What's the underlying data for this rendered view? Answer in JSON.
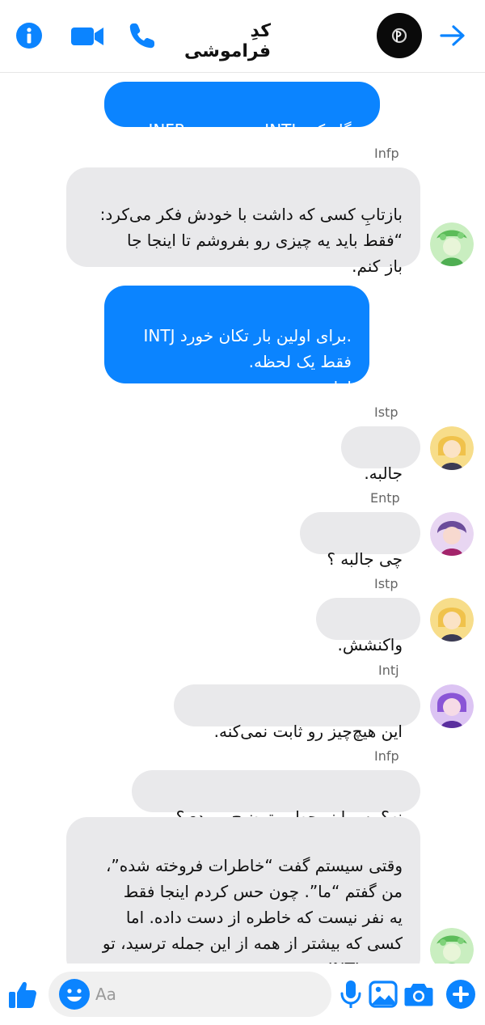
{
  "header": {
    "title": "کدِ فراموشی",
    "icons": {
      "info": "info-icon",
      "video": "video-camera-icon",
      "call": "phone-icon",
      "forward": "arrow-right-icon"
    },
    "accent": "#0b84ff"
  },
  "messages": [
    {
      "text": ".نگاه کرد INTJ مستقیم به INFP"
    },
    {
      "sender": "Infp",
      "text": "بازتابِ کسی که داشت با خودش فکر می‌کرد:\n“فقط باید یه چیزی رو بفروشم تا اینجا جا\nباز کنم."
    },
    {
      "text": ".برای اولین بار تکان خورد INTJ\nفقط یک لحظه.\nاما همه دیدند."
    },
    {
      "sender": "Istp",
      "text": "جالبه."
    },
    {
      "sender": "Entp",
      "text": "چی جالبه ؟"
    },
    {
      "sender": "Istp",
      "text": "واکنشش."
    },
    {
      "sender": "Intj",
      "text": "این هیچ‌چیز رو ثابت نمی‌کنه."
    },
    {
      "sender": "Infp",
      "text": "نه؟ پس اینو چطور توضیح می‌دی؟"
    },
    {
      "text": "وقتی سیستم گفت “خاطرات فروخته شده”،\nمن گفتم “ما”. چون حس کردم اینجا فقط\nیه نفر نیست که خاطره از دست داده. اما\nکسی که بیشتر از همه از این جمله ترسید، تو\nبودی، INTJ."
    }
  ],
  "composer": {
    "placeholder": "Aa",
    "icons": {
      "like": "thumbs-up-icon",
      "emoji": "emoji-icon",
      "mic": "microphone-icon",
      "gallery": "image-icon",
      "camera": "camera-icon",
      "add": "plus-icon"
    }
  },
  "colors": {
    "outgoing": "#0b84ff",
    "incoming": "#e9e9eb"
  }
}
